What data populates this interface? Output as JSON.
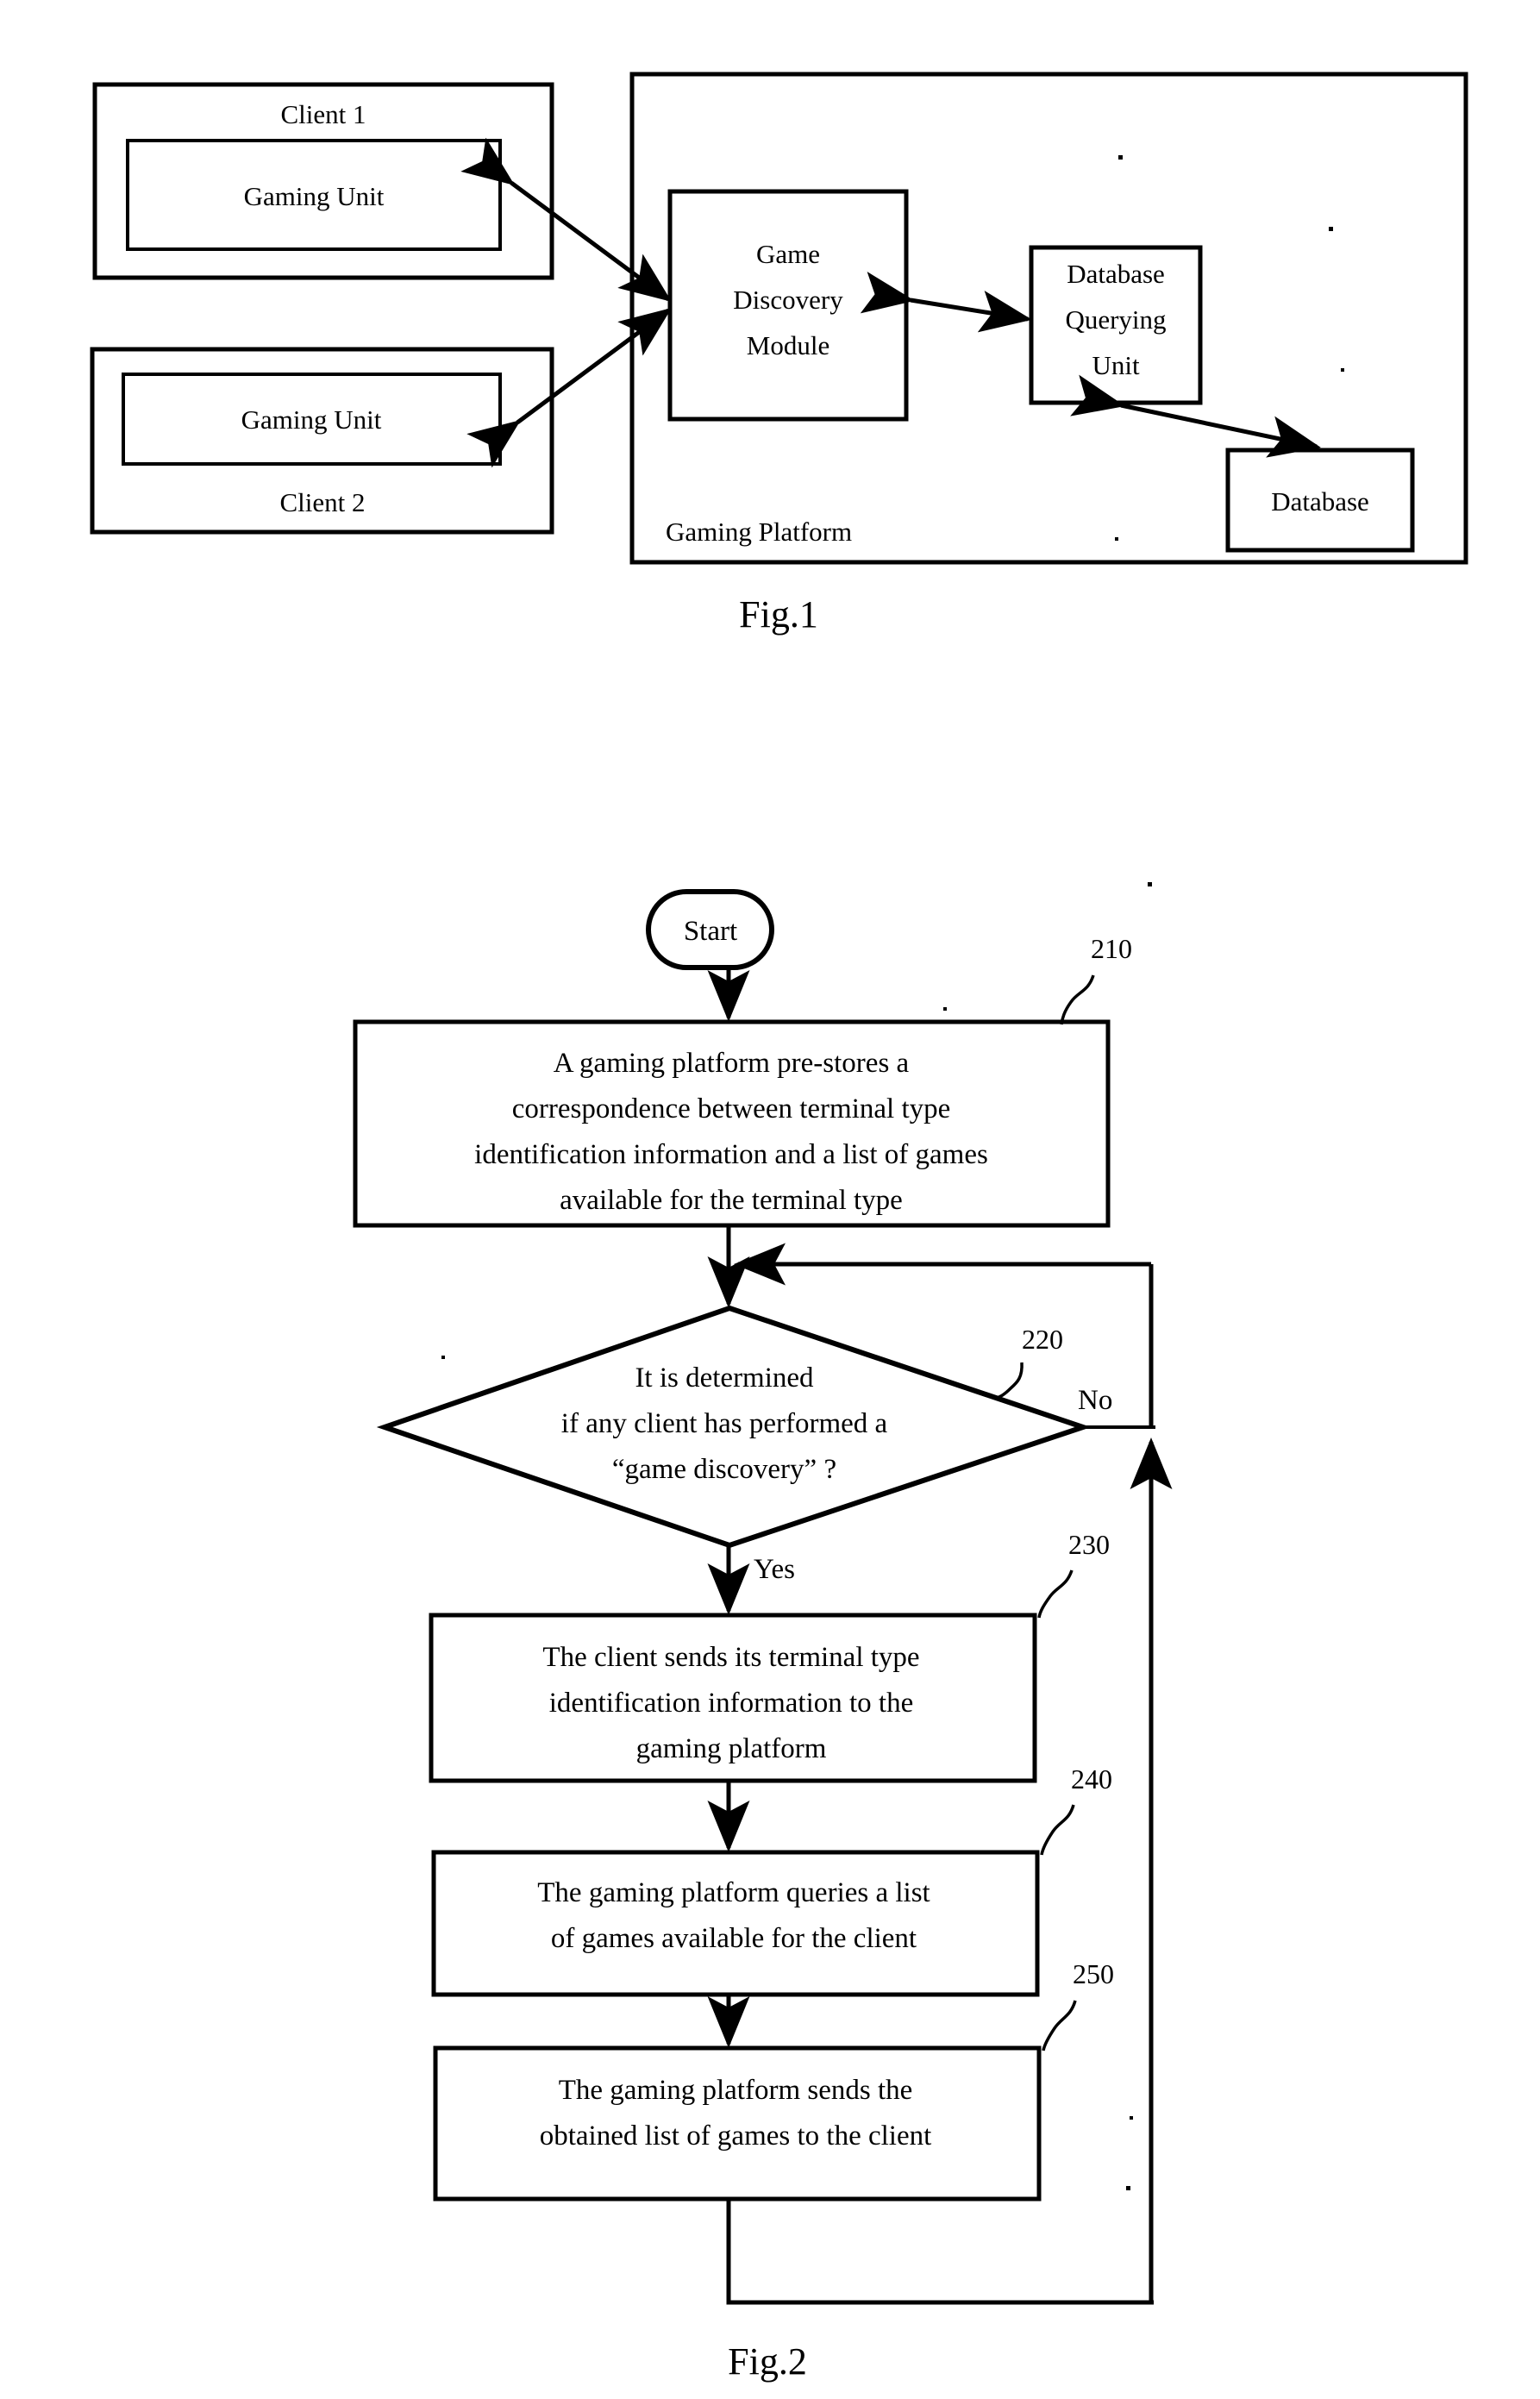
{
  "document": {
    "type": "patent-drawing-sheet",
    "figures": [
      "Fig.1",
      "Fig.2"
    ]
  },
  "fig1": {
    "caption": "Fig.1",
    "client1": {
      "title": "Client 1",
      "inner_label": "Gaming Unit"
    },
    "client2": {
      "title": "Client 2",
      "inner_label": "Gaming Unit"
    },
    "platform": {
      "label": "Gaming Platform",
      "game_discovery_module": "Game\nDiscovery\nModule",
      "game_discovery_module_lines": [
        "Game",
        "Discovery",
        "Module"
      ],
      "database_querying_unit_lines": [
        "Database",
        "Querying",
        "Unit"
      ],
      "database": "Database"
    }
  },
  "fig2": {
    "caption": "Fig.2",
    "start_label": "Start",
    "yes_label": "Yes",
    "no_label": "No",
    "steps": [
      {
        "ref": "210",
        "lines": [
          "A gaming platform pre-stores a",
          "correspondence between terminal type",
          "identification information and a list of games",
          "available for the terminal type"
        ]
      },
      {
        "ref": "220",
        "shape": "decision",
        "lines": [
          "It is determined",
          "if any client has performed a",
          "“game discovery” ?"
        ]
      },
      {
        "ref": "230",
        "lines": [
          "The client sends its terminal type",
          "identification information to the",
          "gaming platform"
        ]
      },
      {
        "ref": "240",
        "lines": [
          "The gaming platform queries a list",
          "of games available for the client"
        ]
      },
      {
        "ref": "250",
        "lines": [
          "The gaming platform sends the",
          "obtained list of games to the client"
        ]
      }
    ]
  },
  "colors": {
    "ink": "#000000",
    "paper": "#ffffff"
  }
}
